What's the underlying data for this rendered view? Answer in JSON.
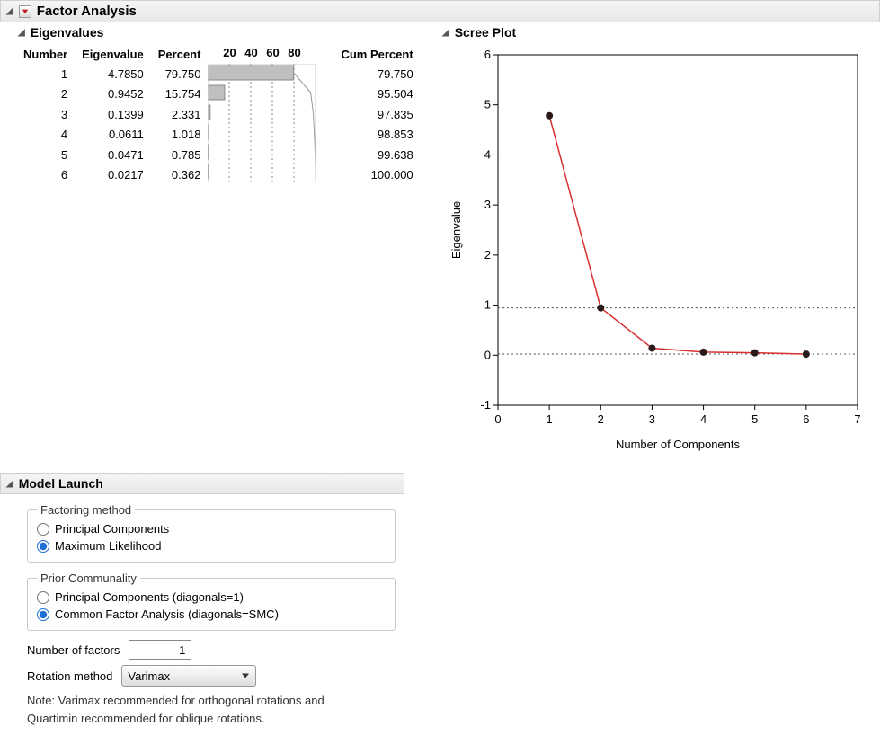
{
  "main": {
    "title": "Factor Analysis"
  },
  "eigen": {
    "title": "Eigenvalues",
    "headers": {
      "number": "Number",
      "eigenvalue": "Eigenvalue",
      "percent": "Percent",
      "cum_percent": "Cum Percent"
    },
    "ticks": [
      "20",
      "40",
      "60",
      "80"
    ],
    "rows": [
      {
        "number": "1",
        "eigenvalue": "4.7850",
        "percent": "79.750",
        "cum": "79.750"
      },
      {
        "number": "2",
        "eigenvalue": "0.9452",
        "percent": "15.754",
        "cum": "95.504"
      },
      {
        "number": "3",
        "eigenvalue": "0.1399",
        "percent": "2.331",
        "cum": "97.835"
      },
      {
        "number": "4",
        "eigenvalue": "0.0611",
        "percent": "1.018",
        "cum": "98.853"
      },
      {
        "number": "5",
        "eigenvalue": "0.0471",
        "percent": "0.785",
        "cum": "99.638"
      },
      {
        "number": "6",
        "eigenvalue": "0.0217",
        "percent": "0.362",
        "cum": "100.000"
      }
    ]
  },
  "scree": {
    "title": "Scree Plot",
    "xlabel": "Number of Components",
    "ylabel": "Eigenvalue"
  },
  "chart_data": {
    "type": "line",
    "x": [
      1,
      2,
      3,
      4,
      5,
      6
    ],
    "y": [
      4.785,
      0.9452,
      0.1399,
      0.0611,
      0.0471,
      0.0217
    ],
    "xlabel": "Number of Components",
    "ylabel": "Eigenvalue",
    "xlim": [
      0,
      7
    ],
    "ylim": [
      -1,
      6
    ],
    "xticks": [
      0,
      1,
      2,
      3,
      4,
      5,
      6,
      7
    ],
    "yticks": [
      -1,
      0,
      1,
      2,
      3,
      4,
      5,
      6
    ],
    "hlines": [
      0.945,
      0.022
    ],
    "title": "Scree Plot"
  },
  "model": {
    "title": "Model Launch",
    "factoring": {
      "legend": "Factoring method",
      "opt1": "Principal Components",
      "opt2": "Maximum Likelihood"
    },
    "prior": {
      "legend": "Prior Communality",
      "opt1": "Principal Components (diagonals=1)",
      "opt2": "Common Factor Analysis (diagonals=SMC)"
    },
    "nfactors_label": "Number of factors",
    "nfactors_value": "1",
    "rotation_label": "Rotation method",
    "rotation_value": "Varimax",
    "note1": "Note: Varimax recommended for orthogonal rotations and",
    "note2": "Quartimin recommended for oblique rotations."
  }
}
